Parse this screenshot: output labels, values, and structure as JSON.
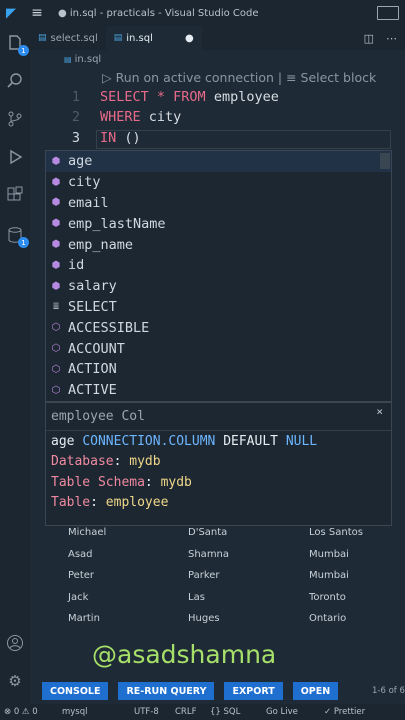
{
  "titlebar": {
    "title": "● in.sql - practicals - Visual Studio Code"
  },
  "activity": {
    "explorer_badge": "1",
    "db_badge": "1"
  },
  "tabs": [
    {
      "label": "select.sql"
    },
    {
      "label": "in.sql",
      "modified_dot": "●"
    }
  ],
  "breadcrumb": "in.sql",
  "codelens": "▷ Run on active connection | ≡ Select block",
  "editor": {
    "line_numbers": [
      "1",
      "2",
      "3"
    ],
    "line1": {
      "kw1": "SELECT",
      "star": " * ",
      "kw2": "FROM",
      "rest": " employee"
    },
    "line2": {
      "kw": "WHERE",
      "rest": " city"
    },
    "line3": {
      "kw": "IN",
      "rest": " ()"
    }
  },
  "suggestions": [
    {
      "label": "age",
      "icon": "column-icon"
    },
    {
      "label": "city",
      "icon": "column-icon"
    },
    {
      "label": "email",
      "icon": "column-icon"
    },
    {
      "label": "emp_lastName",
      "icon": "column-icon"
    },
    {
      "label": "emp_name",
      "icon": "column-icon"
    },
    {
      "label": "id",
      "icon": "column-icon"
    },
    {
      "label": "salary",
      "icon": "column-icon"
    },
    {
      "label": "SELECT",
      "icon": "snippet-icon"
    },
    {
      "label": "ACCESSIBLE",
      "icon": "keyword-icon"
    },
    {
      "label": "ACCOUNT",
      "icon": "keyword-icon"
    },
    {
      "label": "ACTION",
      "icon": "keyword-icon"
    },
    {
      "label": "ACTIVE",
      "icon": "keyword-icon"
    }
  ],
  "details": {
    "header": "employee Col",
    "close": "×",
    "sig": {
      "name": "age ",
      "type": "CONNECTION.COLUMN",
      "default": " DEFAULT ",
      "null": "NULL"
    },
    "database": {
      "label": "Database",
      "value": " mydb"
    },
    "schema": {
      "label": "Table Schema",
      "value": " mydb"
    },
    "table": {
      "label": "Table",
      "value": " employee"
    }
  },
  "results": {
    "rows": [
      [
        "Michael",
        "D'Santa",
        "Los Santos"
      ],
      [
        "Asad",
        "Shamna",
        "Mumbai"
      ],
      [
        "Peter",
        "Parker",
        "Mumbai"
      ],
      [
        "Jack",
        "Las",
        "Toronto"
      ],
      [
        "Martin",
        "Huges",
        "Ontario"
      ]
    ]
  },
  "watermark": "@asadshamna",
  "buttons": {
    "console": "CONSOLE",
    "rerun": "RE-RUN QUERY",
    "export": "EXPORT",
    "open": "OPEN"
  },
  "page_count": "1-6 of 6",
  "statusbar": {
    "problems": "⊗ 0 ⚠ 0",
    "conn": "mysql",
    "encoding": "UTF-8",
    "eol": "CRLF",
    "lang": "{} SQL",
    "golive": "Go Live",
    "prettier": "✓ Prettier"
  },
  "colors": {
    "keyword": "#e86a8a",
    "button": "#1f6fd1",
    "watermark": "#a6e06a"
  }
}
